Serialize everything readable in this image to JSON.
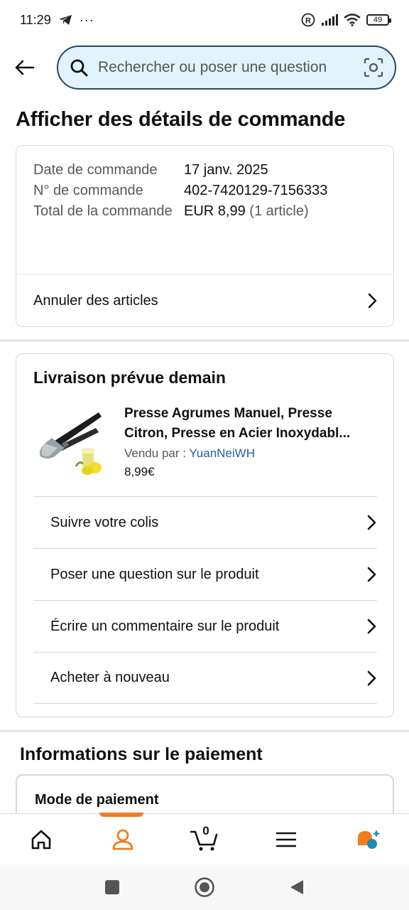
{
  "status_bar": {
    "time": "11:29",
    "battery": "49"
  },
  "search": {
    "placeholder": "Rechercher ou poser une question"
  },
  "page_title": "Afficher des détails de commande",
  "order": {
    "date_label": "Date de commande",
    "date_value": "17 janv. 2025",
    "number_label": "N° de commande",
    "number_value": "402-7420129-7156333",
    "total_label": "Total de la commande",
    "total_value": "EUR 8,99",
    "total_count": "(1 article)",
    "cancel_label": "Annuler des articles"
  },
  "delivery": {
    "heading": "Livraison prévue demain",
    "product_title": "Presse Agrumes Manuel, Presse Citron, Presse en Acier Inoxydabl...",
    "seller_label": "Vendu par  :",
    "seller_name": "YuanNeiWH",
    "price": "8,99€",
    "actions": [
      {
        "label": "Suivre votre colis"
      },
      {
        "label": "Poser une question sur le produit"
      },
      {
        "label": "Écrire un commentaire sur le produit"
      },
      {
        "label": "Acheter à nouveau"
      }
    ]
  },
  "payment": {
    "section_title": "Informations sur le paiement",
    "method_label": "Mode de paiement"
  },
  "bottom_nav": {
    "cart_count": "0",
    "active_tab": "account",
    "tabs": [
      {
        "icon": "home-icon"
      },
      {
        "icon": "account-icon"
      },
      {
        "icon": "cart-icon"
      },
      {
        "icon": "menu-icon"
      },
      {
        "icon": "rufus-assistant-icon"
      }
    ]
  },
  "colors": {
    "accent": "#f47b1f",
    "search_bg": "#e2f3fb",
    "search_border": "#1f4a68",
    "link": "#2162a1"
  }
}
